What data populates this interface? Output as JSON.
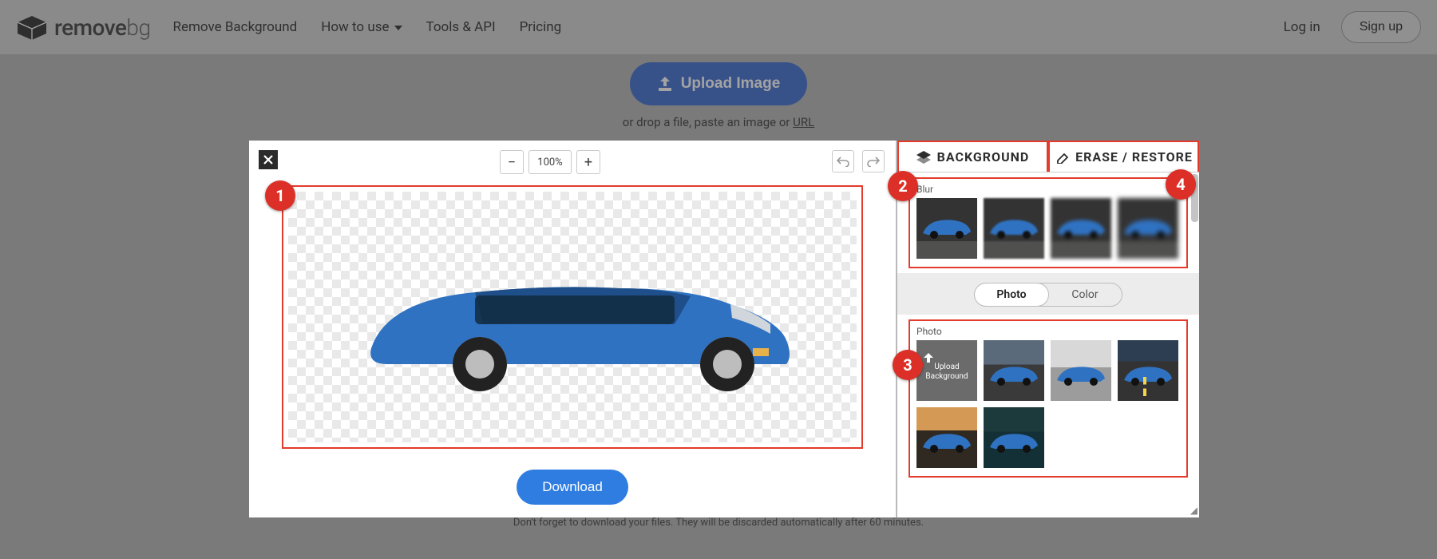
{
  "nav": {
    "brand_prefix": "remove",
    "brand_suffix": "bg",
    "links": {
      "remove_bg": "Remove Background",
      "how_to_use": "How to use",
      "tools_api": "Tools & API",
      "pricing": "Pricing"
    },
    "login": "Log in",
    "signup": "Sign up"
  },
  "hero": {
    "upload_label": "Upload Image",
    "sub_prefix": "or drop a file, paste an image or ",
    "sub_url": "URL"
  },
  "editor": {
    "zoom": "100%",
    "download": "Download",
    "tabs": {
      "background": "BACKGROUND",
      "erase": "ERASE / RESTORE"
    },
    "blur_section": "Blur",
    "photo_section": "Photo",
    "segment": {
      "photo": "Photo",
      "color": "Color"
    },
    "upload_bg": "Upload Background"
  },
  "markers": [
    "1",
    "2",
    "3",
    "4"
  ],
  "footer_note": "Don't forget to download your files. They will be discarded automatically after 60 minutes.",
  "colors": {
    "accent_blue": "#2f7de1",
    "marker_red": "#dc2f27",
    "highlight_border": "#e33b2c",
    "car_blue": "#2f72c2"
  }
}
